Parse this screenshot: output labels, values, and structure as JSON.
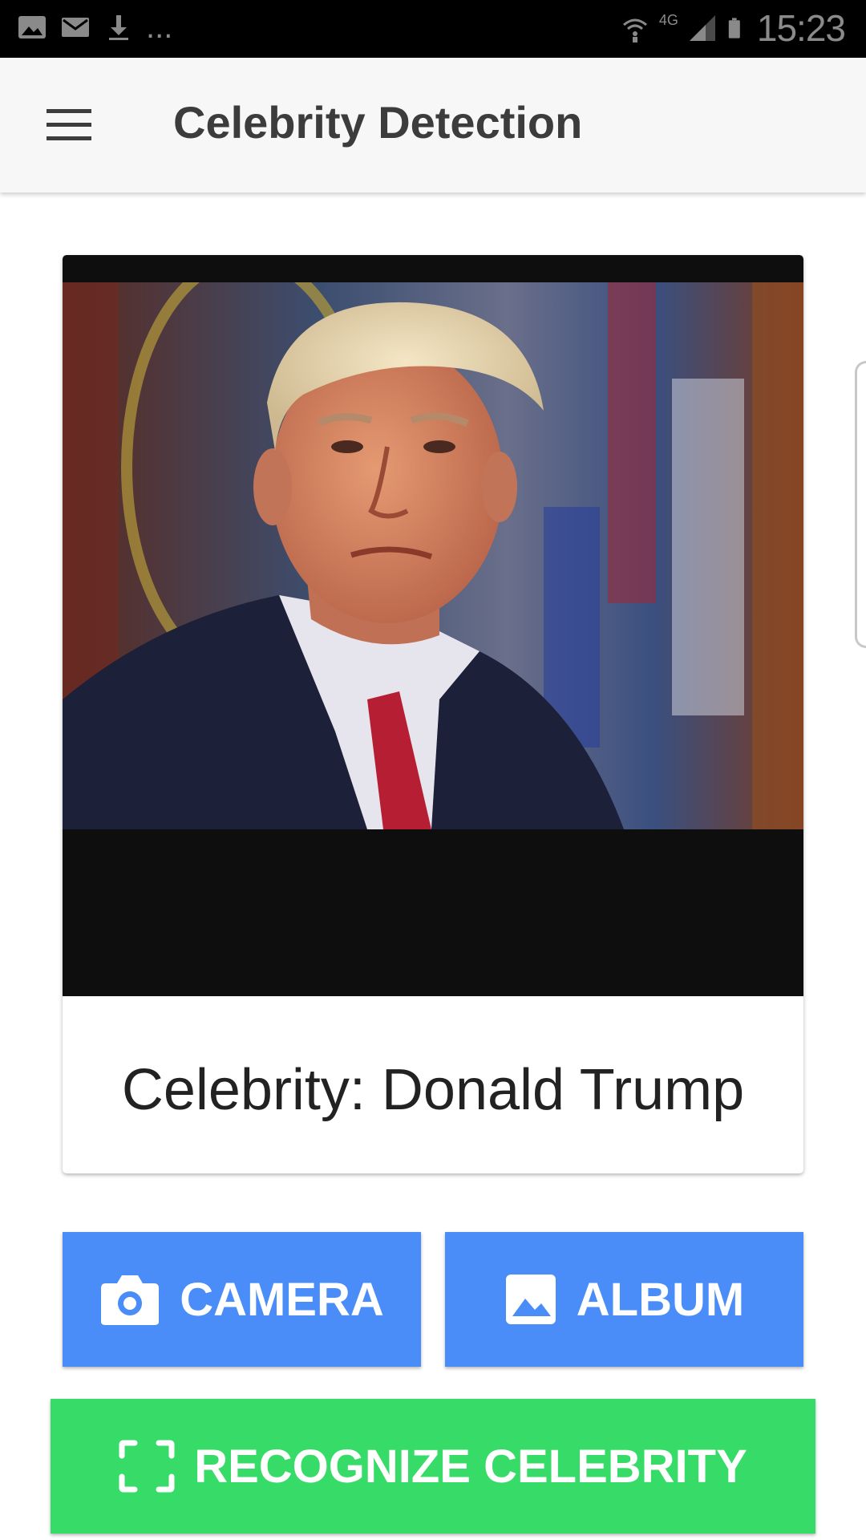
{
  "status_bar": {
    "time": "15:23",
    "overflow_dots": "...",
    "network_type": "4G"
  },
  "app_bar": {
    "title": "Celebrity Detection"
  },
  "result": {
    "text": "Celebrity: Donald Trump"
  },
  "buttons": {
    "camera_label": "CAMERA",
    "album_label": "ALBUM",
    "recognize_label": "RECOGNIZE CELEBRITY"
  },
  "colors": {
    "button_blue": "#4a8df8",
    "button_green": "#37db67",
    "app_bar_bg": "#f7f7f7",
    "status_bar_bg": "#000000"
  },
  "icons": {
    "menu": "hamburger-menu-icon",
    "camera": "camera-icon",
    "album": "image-icon",
    "recognize": "scan-frame-icon"
  }
}
